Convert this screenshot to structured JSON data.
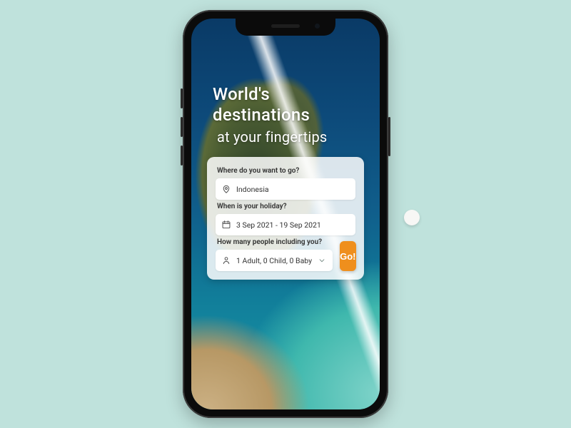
{
  "hero": {
    "line1": "World's destinations",
    "line2": "at your fingertips"
  },
  "search": {
    "destination": {
      "label": "Where do you want to go?",
      "value": "Indonesia"
    },
    "dates": {
      "label": "When is your holiday?",
      "value": "3 Sep 2021 - 19 Sep 2021"
    },
    "people": {
      "label": "How many people including you?",
      "value": "1 Adult, 0 Child, 0 Baby"
    },
    "go_label": "Go!"
  },
  "colors": {
    "accent": "#ef8f1d",
    "page_bg": "#bfe2dc"
  }
}
